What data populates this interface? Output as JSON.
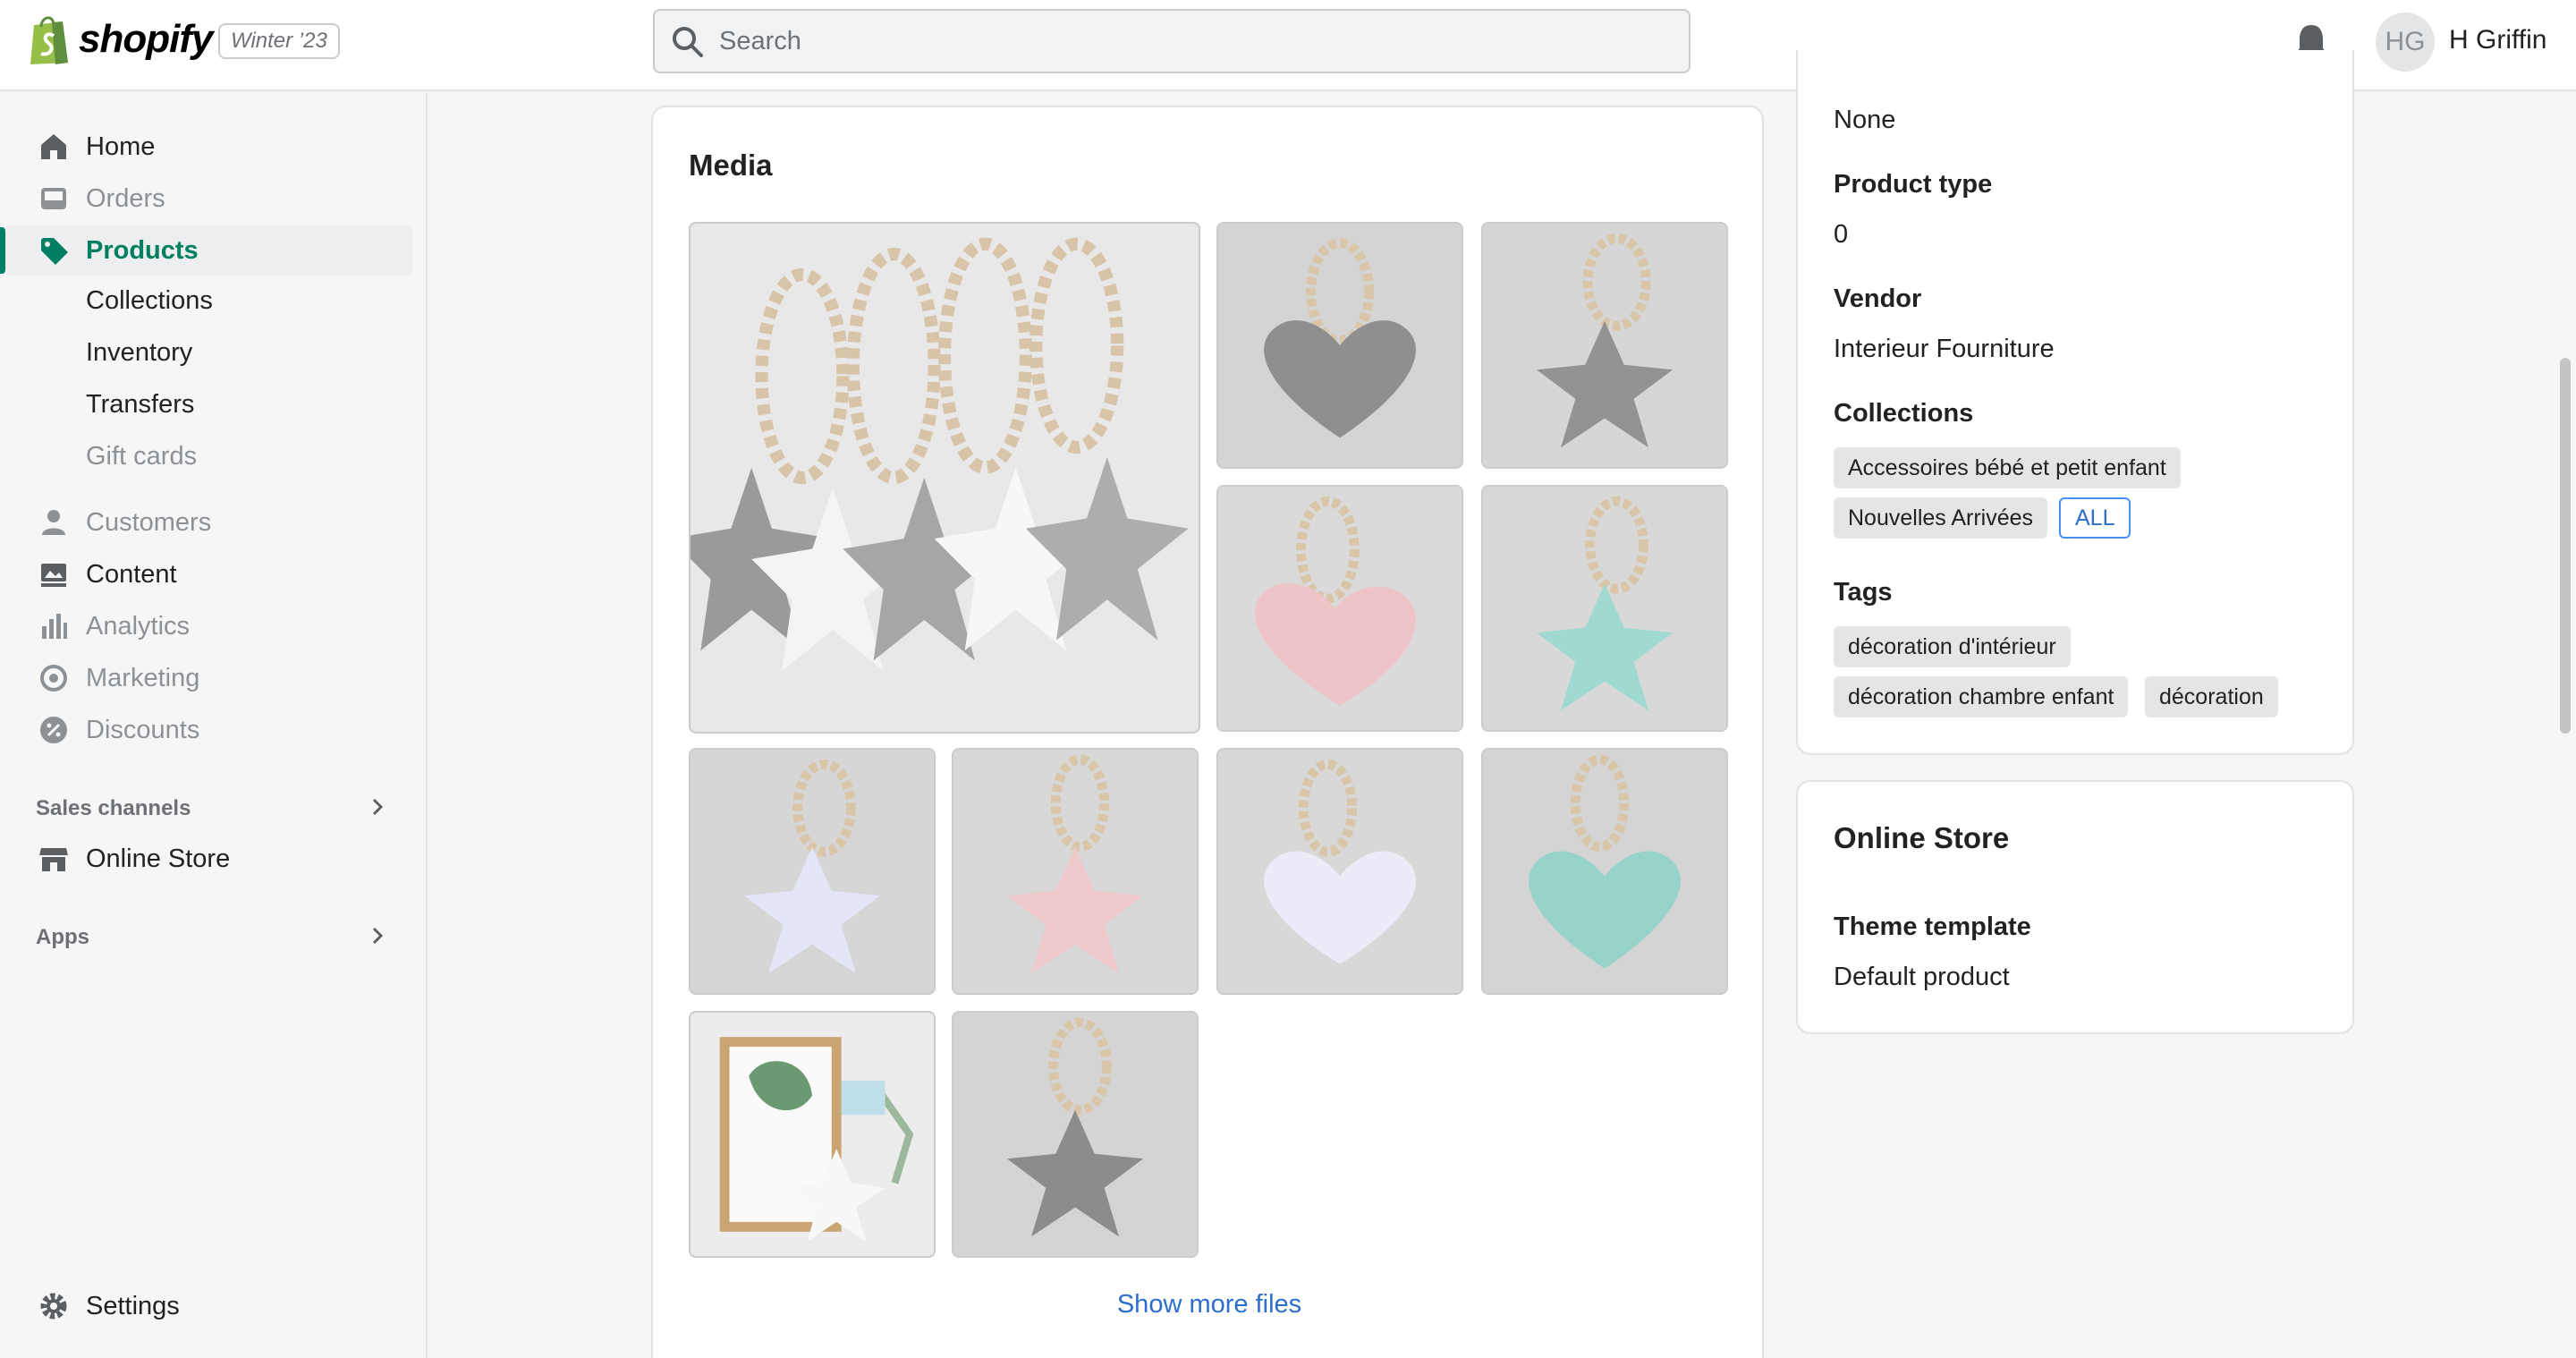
{
  "brand": {
    "name": "shopify",
    "edition": "Winter ’23"
  },
  "search": {
    "placeholder": "Search"
  },
  "user": {
    "initials": "HG",
    "name": "H Griffin"
  },
  "sidebar": {
    "items": [
      {
        "label": "Home",
        "icon": "home-icon"
      },
      {
        "label": "Orders",
        "icon": "inbox-icon"
      },
      {
        "label": "Products",
        "icon": "tag-icon"
      },
      {
        "label": "Customers",
        "icon": "person-icon"
      },
      {
        "label": "Content",
        "icon": "image-icon"
      },
      {
        "label": "Analytics",
        "icon": "bar-chart-icon"
      },
      {
        "label": "Marketing",
        "icon": "target-icon"
      },
      {
        "label": "Discounts",
        "icon": "discount-icon"
      }
    ],
    "products_sub": [
      "Collections",
      "Inventory",
      "Transfers",
      "Gift cards"
    ],
    "sales_channels_label": "Sales channels",
    "online_store_label": "Online Store",
    "apps_label": "Apps",
    "settings_label": "Settings"
  },
  "media": {
    "title": "Media",
    "show_more": "Show more files",
    "thumbs": [
      "stars-group",
      "grey-heart",
      "grey-star",
      "pink-heart",
      "mint-star",
      "lavender-star",
      "pink-star",
      "lavender-heart",
      "mint-heart",
      "clipboard-flatlay",
      "grey-star-2"
    ]
  },
  "organization": {
    "top_value": "None",
    "product_type_label": "Product type",
    "product_type_value": "0",
    "vendor_label": "Vendor",
    "vendor_value": "Interieur Fourniture",
    "collections_label": "Collections",
    "collections": [
      "Accessoires bébé et petit enfant",
      "Nouvelles Arrivées",
      "ALL"
    ],
    "tags_label": "Tags",
    "tags": [
      "décoration d'intérieur",
      "décoration chambre enfant",
      "décoration"
    ]
  },
  "online_store": {
    "title": "Online Store",
    "theme_label": "Theme template",
    "theme_value": "Default product"
  },
  "colors": {
    "accent": "#008060",
    "link": "#2c6ecb"
  }
}
